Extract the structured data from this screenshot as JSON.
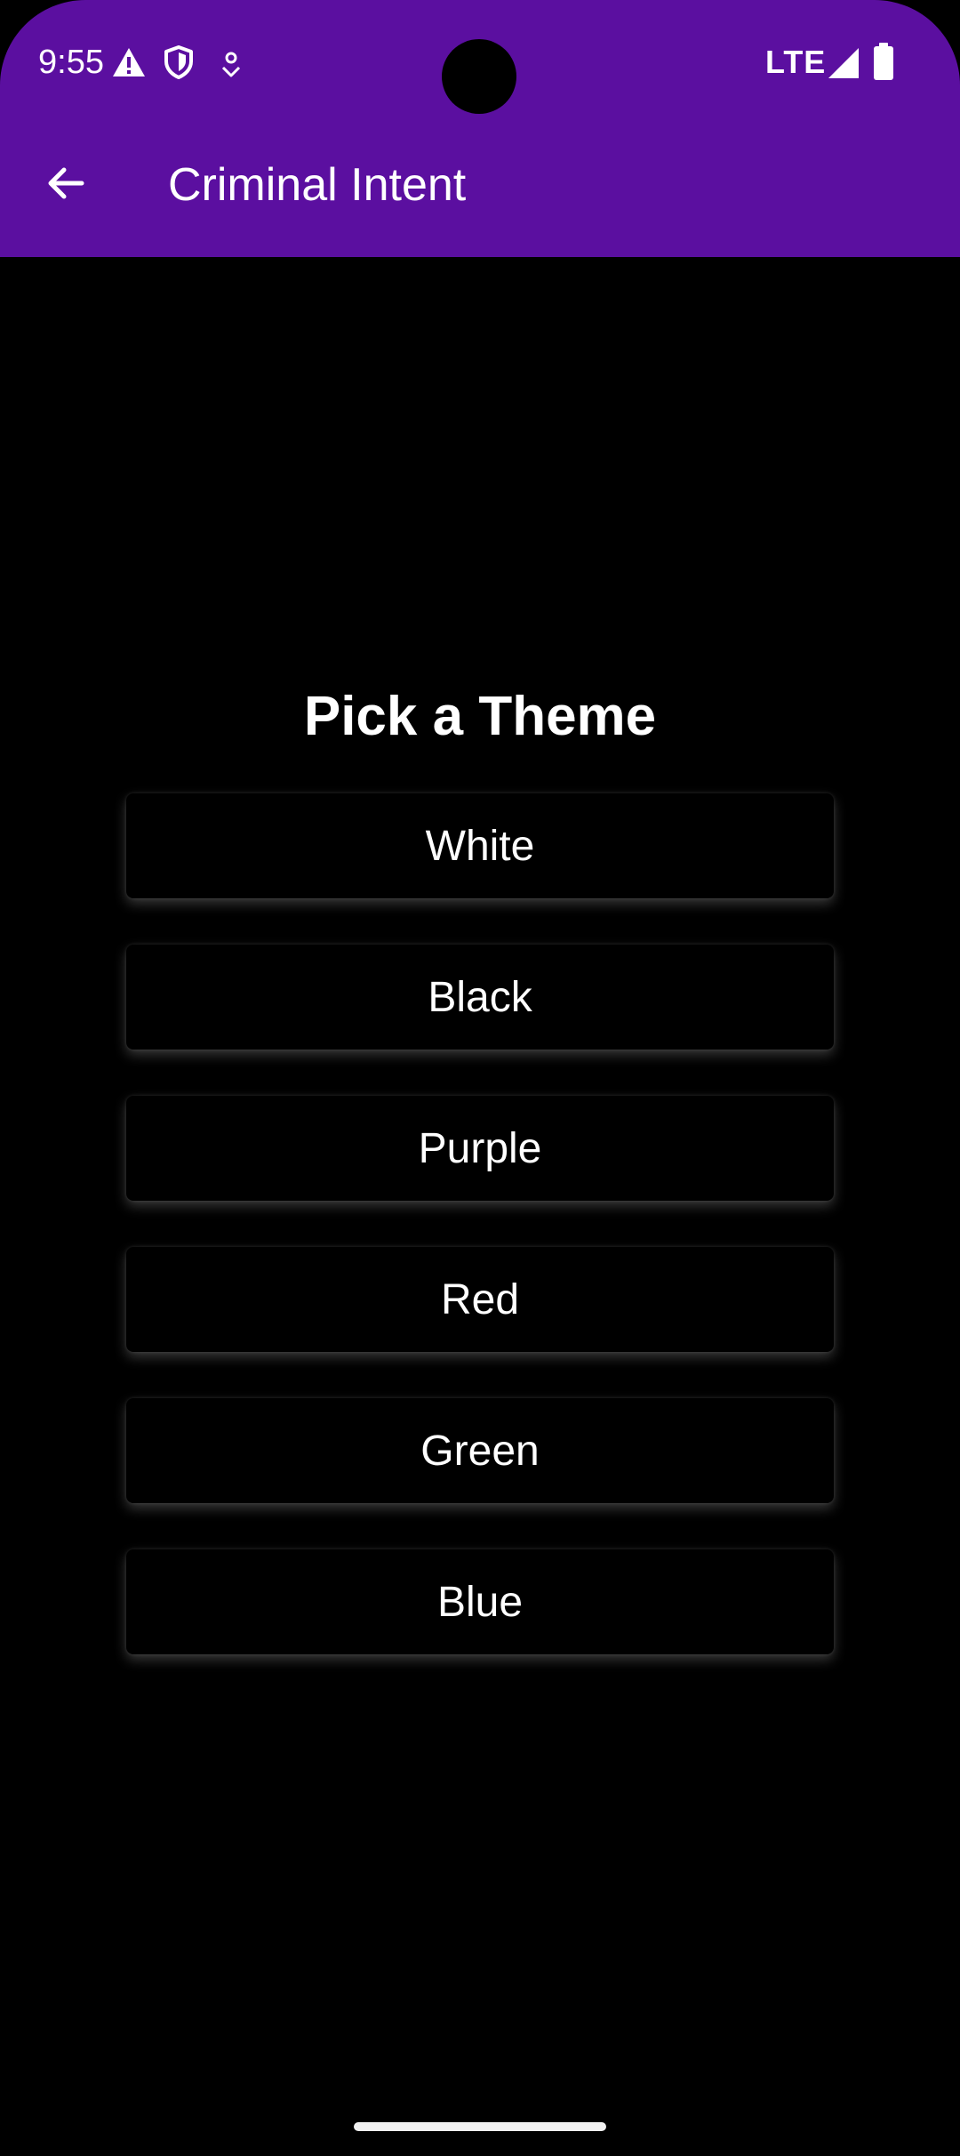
{
  "status_bar": {
    "time": "9:55",
    "network": "LTE",
    "icons": [
      "warning-icon",
      "shield-icon",
      "location-pin-icon",
      "signal-icon",
      "battery-icon"
    ]
  },
  "toolbar": {
    "title": "Criminal Intent",
    "back_icon": "arrow-back-icon"
  },
  "main": {
    "heading": "Pick a Theme",
    "options": [
      "White",
      "Black",
      "Purple",
      "Red",
      "Green",
      "Blue"
    ]
  },
  "colors": {
    "app_bar": "#5b0fa0",
    "background": "#000000",
    "text": "#ffffff"
  }
}
